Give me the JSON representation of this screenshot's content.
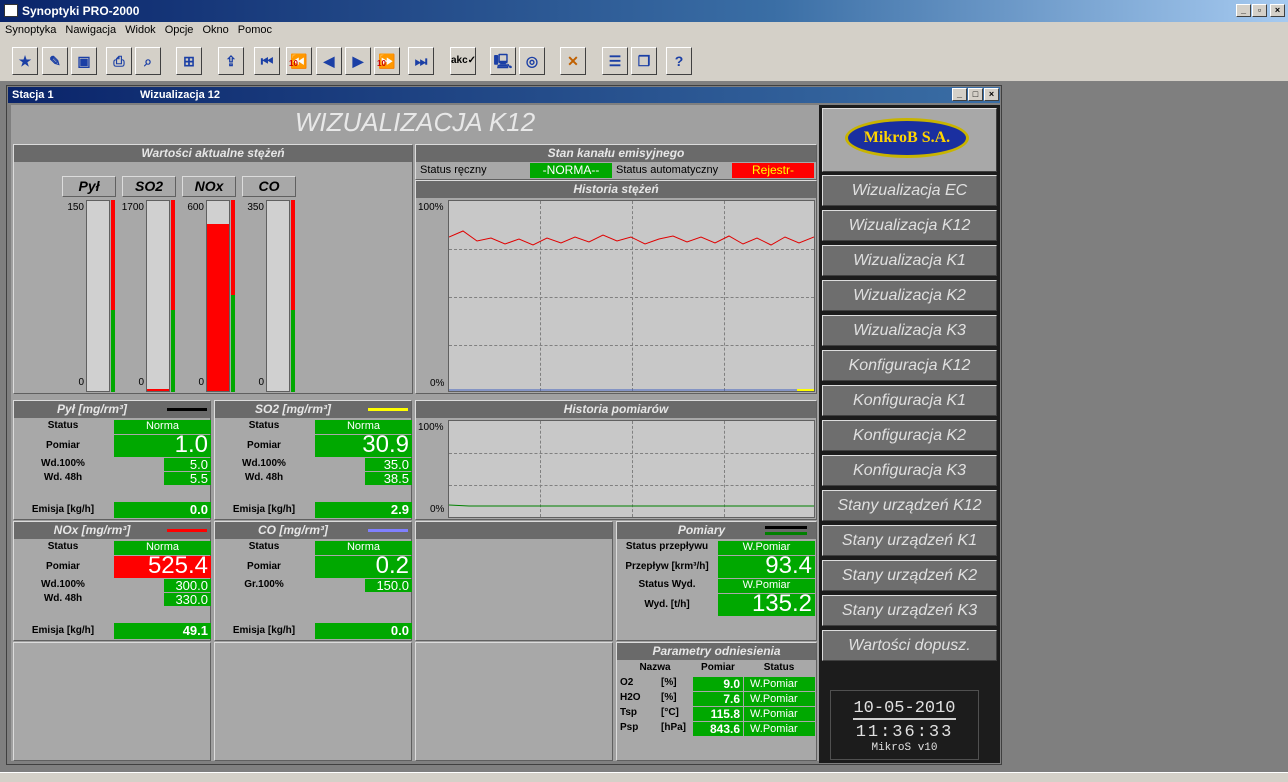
{
  "app": {
    "title": "Synoptyki PRO-2000"
  },
  "menu": [
    "Synoptyka",
    "Nawigacja",
    "Widok",
    "Opcje",
    "Okno",
    "Pomoc"
  ],
  "child": {
    "station": "Stacja 1",
    "view": "Wizualizacja 12"
  },
  "page_title": "WIZUALIZACJA K12",
  "logo": "MikroB S.A.",
  "current": {
    "header": "Wartości aktualne stężeń",
    "bars": [
      {
        "name": "Pył",
        "max": "150",
        "min": "0",
        "fill": 0.0
      },
      {
        "name": "SO2",
        "max": "1700",
        "min": "0",
        "fill": 0.01
      },
      {
        "name": "NOx",
        "max": "600",
        "min": "0",
        "fill": 0.88
      },
      {
        "name": "CO",
        "max": "350",
        "min": "0",
        "fill": 0.0
      }
    ]
  },
  "channel": {
    "header": "Stan kanału emisyjnego",
    "manual_label": "Status ręczny",
    "manual_value": "-NORMA--",
    "auto_label": "Status automatyczny",
    "auto_value": "Rejestr-"
  },
  "hist_conc": {
    "header": "Historia stężeń",
    "ymax": "100%",
    "ymin": "0%"
  },
  "hist_meas": {
    "header": "Historia pomiarów",
    "ymax": "100%",
    "ymin": "0%"
  },
  "labels": {
    "status": "Status",
    "pomiar": "Pomiar",
    "wd100": "Wd.100%",
    "wd48": "Wd. 48h",
    "gr100": "Gr.100%",
    "emisja": "Emisja [kg/h]"
  },
  "pyl": {
    "header": "Pył [mg/rm³]",
    "status": "Norma",
    "pomiar": "1.0",
    "wd100": "5.0",
    "wd48": "5.5",
    "emisja": "0.0",
    "color": "#000000"
  },
  "so2": {
    "header": "SO2 [mg/rm³]",
    "status": "Norma",
    "pomiar": "30.9",
    "wd100": "35.0",
    "wd48": "38.5",
    "emisja": "2.9",
    "color": "#ffff00"
  },
  "nox": {
    "header": "NOx [mg/rm³]",
    "status": "Norma",
    "pomiar": "525.4",
    "wd100": "300.0",
    "wd48": "330.0",
    "emisja": "49.1",
    "color": "#ff0000"
  },
  "co": {
    "header": "CO [mg/rm³]",
    "status": "Norma",
    "pomiar": "0.2",
    "gr100": "150.0",
    "emisja": "0.0",
    "color": "#8080ff"
  },
  "pomiary": {
    "header": "Pomiary",
    "flow_status_label": "Status przepływu",
    "flow_status": "W.Pomiar",
    "flow_label": "Przepływ [krm³/h]",
    "flow": "93.4",
    "hum_status_label": "Status Wyd.",
    "hum_status": "W.Pomiar",
    "hum_label": "Wyd. [t/h]",
    "hum": "135.2"
  },
  "params": {
    "header": "Parametry odniesienia",
    "cols": [
      "Nazwa",
      "Pomiar",
      "Status"
    ],
    "rows": [
      {
        "name": "O2",
        "unit": "[%]",
        "value": "9.0",
        "status": "W.Pomiar"
      },
      {
        "name": "H2O",
        "unit": "[%]",
        "value": "7.6",
        "status": "W.Pomiar"
      },
      {
        "name": "Tsp",
        "unit": "[°C]",
        "value": "115.8",
        "status": "W.Pomiar"
      },
      {
        "name": "Psp",
        "unit": "[hPa]",
        "value": "843.6",
        "status": "W.Pomiar"
      }
    ]
  },
  "nav": [
    "Wizualizacja EC",
    "Wizualizacja K12",
    "Wizualizacja K1",
    "Wizualizacja K2",
    "Wizualizacja K3",
    "Konfiguracja K12",
    "Konfiguracja K1",
    "Konfiguracja K2",
    "Konfiguracja K3",
    "Stany urządzeń K12",
    "Stany urządzeń K1",
    "Stany urządzeń K2",
    "Stany urządzeń K3",
    "Wartości dopusz."
  ],
  "clock": {
    "date": "10-05-2010",
    "time": "11:36:33",
    "version": "MikroS v10"
  },
  "toolbar_icons": [
    "star-icon",
    "edit-icon",
    "save-icon",
    "print-icon",
    "print-preview-icon",
    "fit-icon",
    "export-icon",
    "first-icon",
    "rewind-10-icon",
    "prev-icon",
    "next-icon",
    "forward-10-icon",
    "last-icon",
    "acknowledge-icon",
    "computer-icon",
    "tape-icon",
    "tools-icon",
    "tile-icon",
    "cascade-icon",
    "help-icon"
  ]
}
